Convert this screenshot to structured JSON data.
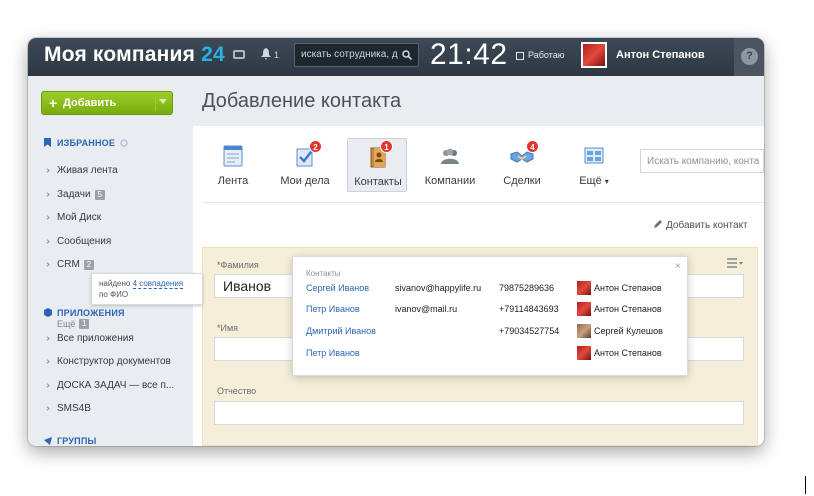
{
  "header": {
    "logo_text": "Моя компания",
    "logo_num": "24",
    "notif_count": "1",
    "search_placeholder": "искать сотрудника, д",
    "clock": "21:42",
    "work_status": "Работаю",
    "user_name": "Антон Степанов",
    "help_label": "?"
  },
  "sidebar": {
    "add_button": "Добавить",
    "favorites_title": "ИЗБРАННОЕ",
    "favorites": [
      {
        "label": "Живая лента"
      },
      {
        "label": "Задачи",
        "count": "5"
      },
      {
        "label": "Мой Диск"
      },
      {
        "label": "Сообщения"
      },
      {
        "label": "CRM",
        "count": "2"
      }
    ],
    "more_label": "Ещё",
    "more_count": "1",
    "apps_title": "ПРИЛОЖЕНИЯ",
    "apps": [
      {
        "label": "Все приложения"
      },
      {
        "label": "Конструктор документов"
      },
      {
        "label": "ДОСКА ЗАДАЧ — все п..."
      },
      {
        "label": "SMS4B"
      }
    ],
    "groups_title": "ГРУППЫ"
  },
  "tooltip": {
    "prefix": "найдено",
    "link": "4 совпадения",
    "suffix": "по ФИО"
  },
  "main": {
    "page_title": "Добавление контакта",
    "tabs": [
      {
        "label": "Лента",
        "badge": null
      },
      {
        "label": "Мои дела",
        "badge": "2"
      },
      {
        "label": "Контакты",
        "badge": "1"
      },
      {
        "label": "Компании",
        "badge": null
      },
      {
        "label": "Сделки",
        "badge": "4"
      },
      {
        "label": "Ещё",
        "badge": null
      }
    ],
    "search_placeholder": "Искать компанию, конта",
    "add_contact": "Добавить контакт"
  },
  "form": {
    "last_name_label": "Фамилия",
    "last_name_value": "Иванов",
    "first_name_label": "Имя",
    "middle_name_label": "Отчество",
    "required_mark": "*"
  },
  "popup": {
    "title": "Контакты",
    "close": "×",
    "rows": [
      {
        "name": "Сергей Иванов",
        "email": "sivanov@happylife.ru",
        "phone": "79875289636",
        "owner": "Антон Степанов"
      },
      {
        "name": "Петр Иванов",
        "email": "ivanov@mail.ru",
        "phone": "+79114843693",
        "owner": "Антон Степанов"
      },
      {
        "name": "Дмитрий Иванов",
        "email": "",
        "phone": "+79034527754",
        "owner": "Сергей Кулешов"
      },
      {
        "name": "Петр Иванов",
        "email": "",
        "phone": "",
        "owner": "Антон Степанов"
      }
    ]
  },
  "colors": {
    "header_bg": "#2c3742",
    "accent_blue": "#29b1e6",
    "link_blue": "#2a66b4",
    "add_green": "#77ad0c",
    "badge_red": "#e0362d",
    "form_bg": "#f5efd9"
  }
}
